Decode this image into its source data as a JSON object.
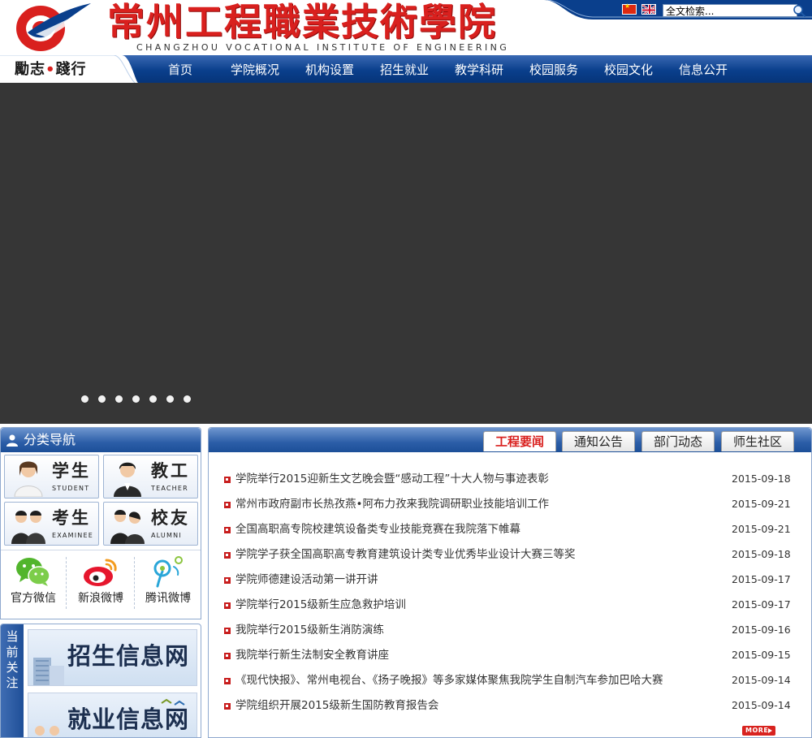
{
  "header": {
    "title_cn": "常州工程職業技術學院",
    "title_en": "CHANGZHOU VOCATIONAL INSTITUTE OF ENGINEERING",
    "motto_left": "勵志",
    "motto_dot": "•",
    "motto_right": "踐行"
  },
  "topbar": {
    "search_value": "全文检索..."
  },
  "nav": {
    "items": [
      "首页",
      "学院概况",
      "机构设置",
      "招生就业",
      "教学科研",
      "校园服务",
      "校园文化",
      "信息公开"
    ]
  },
  "category_nav": {
    "title": "分类导航",
    "roles": [
      {
        "cn": "学生",
        "en": "STUDENT"
      },
      {
        "cn": "教工",
        "en": "TEACHER"
      },
      {
        "cn": "考生",
        "en": "EXAMINEE"
      },
      {
        "cn": "校友",
        "en": "ALUMNI"
      }
    ],
    "social": [
      {
        "label": "官方微信"
      },
      {
        "label": "新浪微博"
      },
      {
        "label": "腾讯微博"
      }
    ]
  },
  "focus": {
    "label": "当前关注",
    "banners": [
      "招生信息网",
      "就业信息网"
    ]
  },
  "news": {
    "tabs": [
      "工程要闻",
      "通知公告",
      "部门动态",
      "师生社区"
    ],
    "items": [
      {
        "title": "学院举行2015迎新生文艺晚会暨“感动工程”十大人物与事迹表彰",
        "date": "2015-09-18"
      },
      {
        "title": "常州市政府副市长热孜燕•阿布力孜来我院调研职业技能培训工作",
        "date": "2015-09-21"
      },
      {
        "title": "全国高职高专院校建筑设备类专业技能竞赛在我院落下帷幕",
        "date": "2015-09-21"
      },
      {
        "title": "学院学子获全国高职高专教育建筑设计类专业优秀毕业设计大赛三等奖",
        "date": "2015-09-18"
      },
      {
        "title": "学院师德建设活动第一讲开讲",
        "date": "2015-09-17"
      },
      {
        "title": "学院举行2015级新生应急救护培训",
        "date": "2015-09-17"
      },
      {
        "title": "我院举行2015级新生消防演练",
        "date": "2015-09-16"
      },
      {
        "title": "我院举行新生法制安全教育讲座",
        "date": "2015-09-15"
      },
      {
        "title": "《现代快报》、常州电视台、《扬子晚报》等多家媒体聚焦我院学生自制汽车参加巴哈大赛",
        "date": "2015-09-14"
      },
      {
        "title": "学院组织开展2015级新生国防教育报告会",
        "date": "2015-09-14"
      }
    ],
    "more_label": "MORE"
  },
  "colors": {
    "brand_blue": "#0a3f8c",
    "brand_red": "#d9201e",
    "slide_bg": "#363636"
  }
}
